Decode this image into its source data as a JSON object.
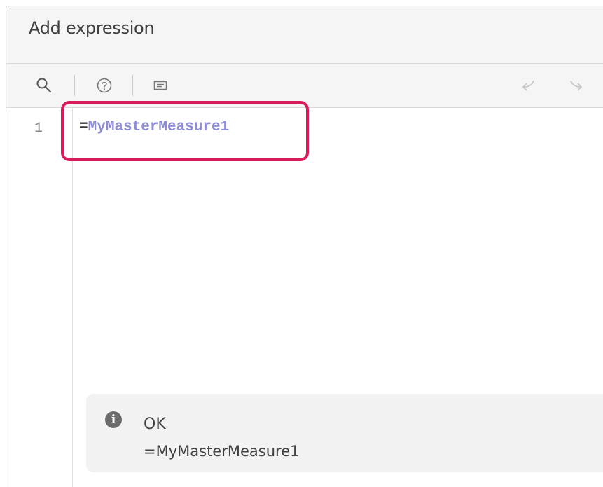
{
  "dialog": {
    "title": "Add expression"
  },
  "toolbar": {
    "search_icon": "search-icon",
    "help_icon": "help-icon",
    "comment_icon": "comment-icon",
    "undo_icon": "undo-icon",
    "redo_icon": "redo-icon"
  },
  "editor": {
    "line_number": "1",
    "code_prefix": "=",
    "code_measure": "MyMasterMeasure1",
    "highlight_color": "#d81b5d",
    "measure_color": "#8d8dd6"
  },
  "status": {
    "icon": "info-icon",
    "title": "OK",
    "expression": "=MyMasterMeasure1"
  }
}
